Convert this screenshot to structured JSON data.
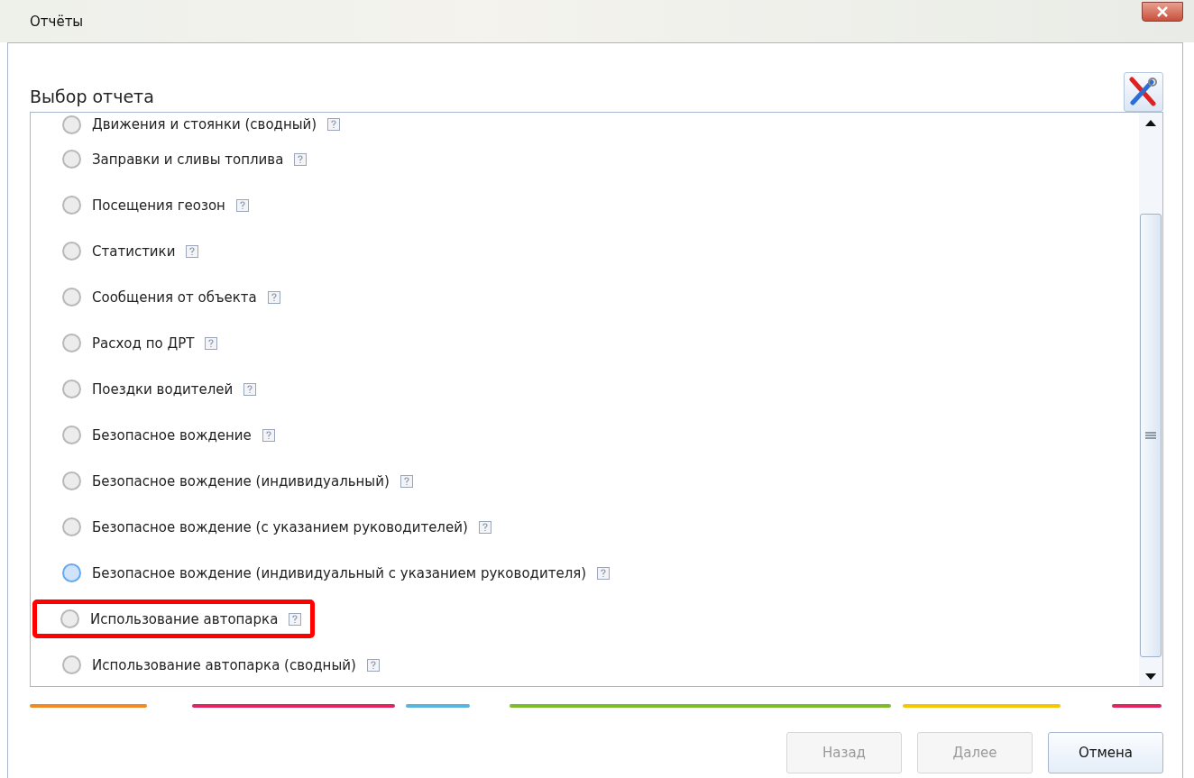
{
  "window": {
    "title": "Отчёты"
  },
  "heading": "Выбор отчета",
  "reports": [
    {
      "label": "Движения и стоянки (сводный)",
      "hovered": false,
      "highlighted": false
    },
    {
      "label": "Заправки и сливы топлива",
      "hovered": false,
      "highlighted": false
    },
    {
      "label": "Посещения геозон",
      "hovered": false,
      "highlighted": false
    },
    {
      "label": "Статистики",
      "hovered": false,
      "highlighted": false
    },
    {
      "label": "Сообщения от объекта",
      "hovered": false,
      "highlighted": false
    },
    {
      "label": "Расход по ДРТ",
      "hovered": false,
      "highlighted": false
    },
    {
      "label": "Поездки водителей",
      "hovered": false,
      "highlighted": false
    },
    {
      "label": "Безопасное вождение",
      "hovered": false,
      "highlighted": false
    },
    {
      "label": "Безопасное вождение (индивидуальный)",
      "hovered": false,
      "highlighted": false
    },
    {
      "label": "Безопасное вождение (с указанием руководителей)",
      "hovered": false,
      "highlighted": false
    },
    {
      "label": "Безопасное вождение (индивидуальный с указанием руководителя)",
      "hovered": true,
      "highlighted": false
    },
    {
      "label": "Использование автопарка",
      "hovered": false,
      "highlighted": true
    },
    {
      "label": "Использование автопарка (сводный)",
      "hovered": false,
      "highlighted": false
    }
  ],
  "stripes": [
    {
      "color": "#f08a24"
    },
    {
      "color": "#e0245e"
    },
    {
      "color": "#5ab4e0"
    },
    {
      "color": "#7cbb2a"
    },
    {
      "color": "#f7c600"
    },
    {
      "color": "#e0245e"
    }
  ],
  "buttons": [
    {
      "label": "Назад",
      "disabled": true
    },
    {
      "label": "Далее",
      "disabled": true
    },
    {
      "label": "Отмена",
      "disabled": false
    }
  ]
}
